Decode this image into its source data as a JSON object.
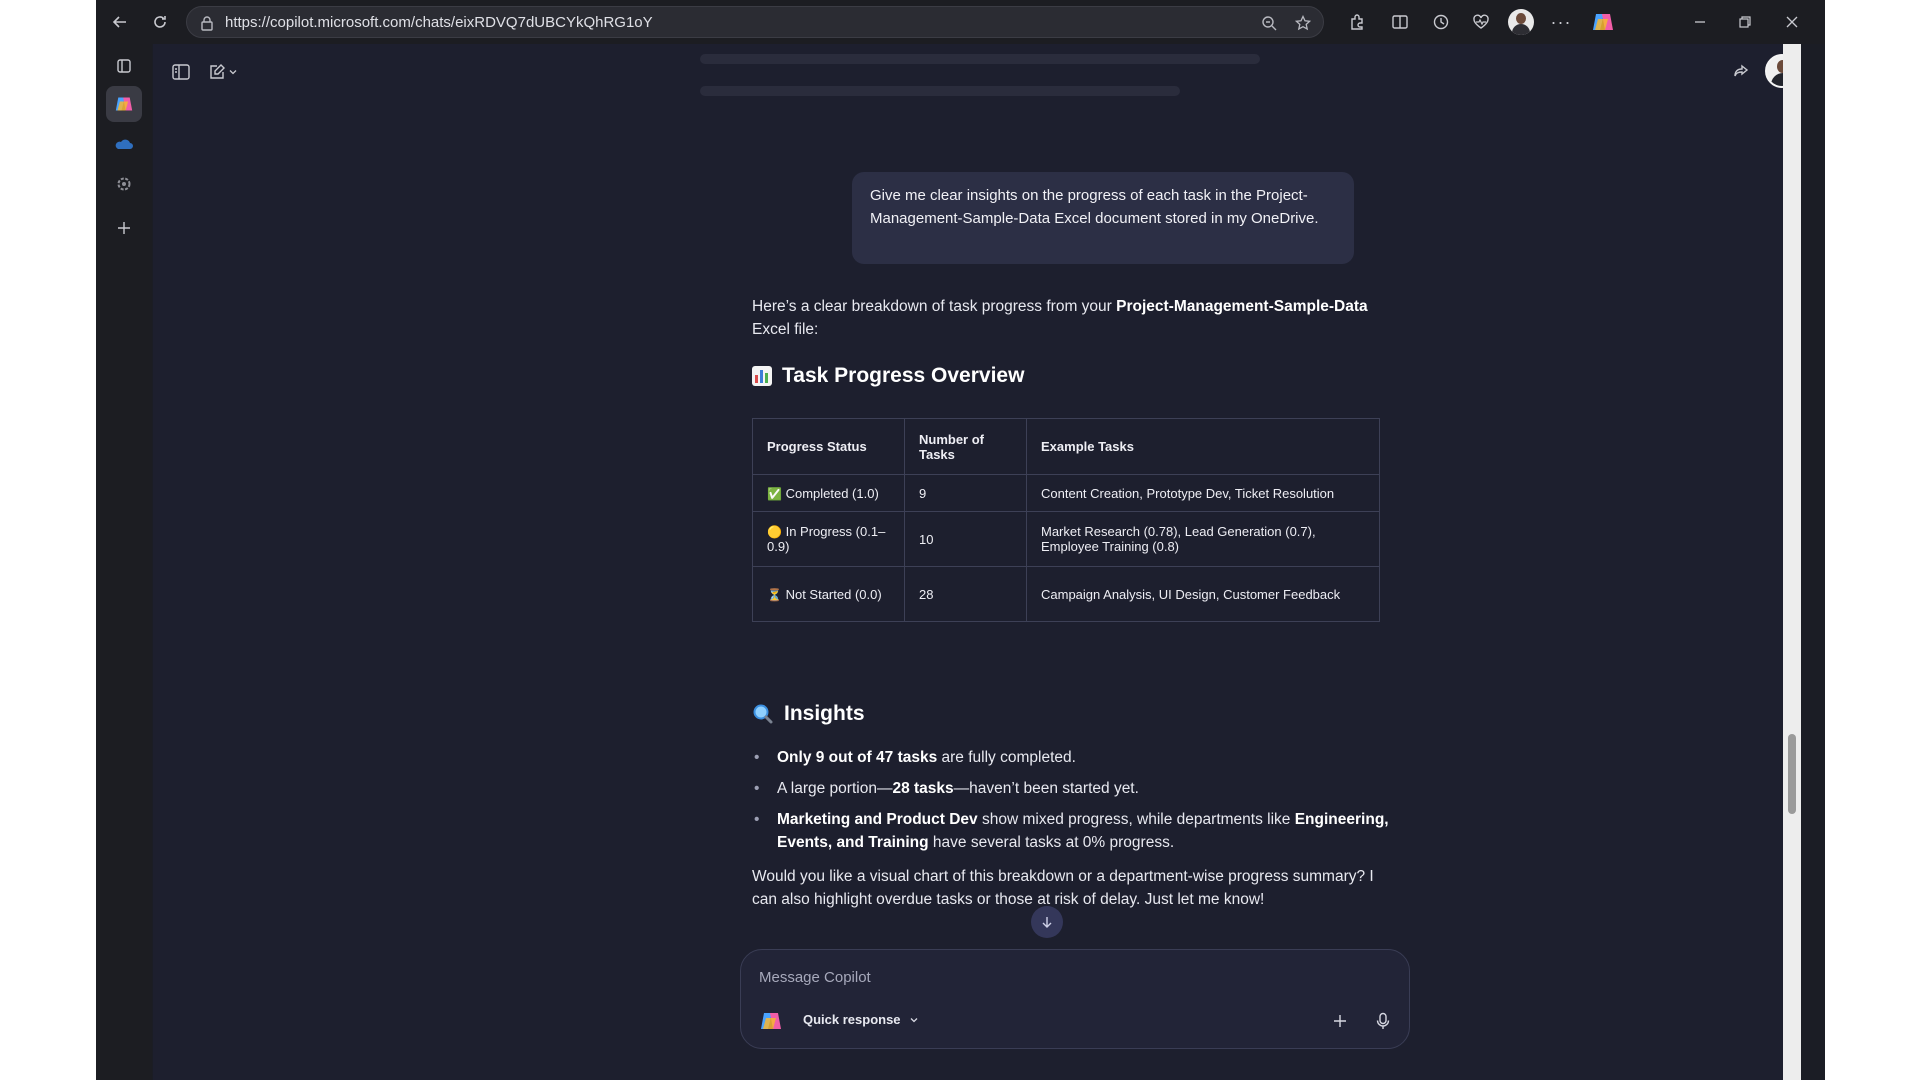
{
  "browser": {
    "url": "https://copilot.microsoft.com/chats/eixRDVQ7dUBCYkQhRG1oY",
    "window_controls": [
      "minimize",
      "restore",
      "close"
    ]
  },
  "chat": {
    "user_message": "Give me clear insights on the progress of each task in the Project-Management-Sample-Data Excel document stored in my OneDrive.",
    "intro_prefix": "Here’s a clear breakdown of task progress from your ",
    "intro_bold": "Project-Management-Sample-Data",
    "intro_suffix": " Excel file:",
    "overview_heading": "Task Progress Overview",
    "table": {
      "headers": [
        "Progress Status",
        "Number of Tasks",
        "Example Tasks"
      ],
      "rows": [
        {
          "icon": "✅",
          "status": "Completed (1.0)",
          "count": "9",
          "examples": "Content Creation, Prototype Dev, Ticket Resolution"
        },
        {
          "icon": "🟡",
          "status": "In Progress (0.1–0.9)",
          "count": "10",
          "examples": "Market Research (0.78), Lead Generation (0.7), Employee Training (0.8)"
        },
        {
          "icon": "⏳",
          "status": "Not Started (0.0)",
          "count": "28",
          "examples": "Campaign Analysis, UI Design, Customer Feedback"
        }
      ]
    },
    "insights_heading": "Insights",
    "insights": [
      {
        "bold": "Only 9 out of 47 tasks",
        "rest": " are fully completed."
      },
      {
        "pre": "A large portion—",
        "bold": "28 tasks",
        "rest": "—haven’t been started yet."
      },
      {
        "bold": "Marketing and Product Dev",
        "rest": " show mixed progress, while departments like ",
        "bold2": "Engineering, Events, and Training",
        "rest2": " have several tasks at 0% progress."
      }
    ],
    "closing": "Would you like a visual chart of this breakdown or a department-wise progress summary? I can also highlight overdue tasks or those at risk of delay. Just let me know!"
  },
  "composer": {
    "placeholder": "Message Copilot",
    "mode_label": "Quick response"
  },
  "colors": {
    "background": "#1d1f2e",
    "bubble": "#2c2f45",
    "accent": "#34375a"
  }
}
